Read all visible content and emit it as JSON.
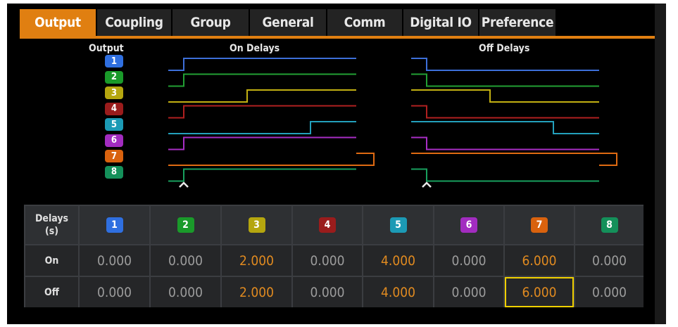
{
  "tabs": [
    {
      "label": "Output",
      "active": true
    },
    {
      "label": "Coupling",
      "active": false
    },
    {
      "label": "Group",
      "active": false
    },
    {
      "label": "General",
      "active": false
    },
    {
      "label": "Comm",
      "active": false
    },
    {
      "label": "Digital IO",
      "active": false
    },
    {
      "label": "Preference",
      "active": false
    }
  ],
  "diagram": {
    "output_label": "Output",
    "on_title": "On Delays",
    "off_title": "Off Delays",
    "marker": "^"
  },
  "outputs": [
    {
      "label": "1",
      "color": "#2f6fe0",
      "line": "#3d6fd9",
      "on": 0.0,
      "off": 0.0
    },
    {
      "label": "2",
      "color": "#1a9a2a",
      "line": "#22a033",
      "on": 0.0,
      "off": 0.0
    },
    {
      "label": "3",
      "color": "#b5a60f",
      "line": "#c2b012",
      "on": 2.0,
      "off": 2.0
    },
    {
      "label": "4",
      "color": "#9a1c1c",
      "line": "#b02020",
      "on": 0.0,
      "off": 0.0
    },
    {
      "label": "5",
      "color": "#1c9ab5",
      "line": "#23a0bc",
      "on": 4.0,
      "off": 4.0
    },
    {
      "label": "6",
      "color": "#a22cc0",
      "line": "#a72ec5",
      "on": 0.0,
      "off": 0.0
    },
    {
      "label": "7",
      "color": "#d9620e",
      "line": "#df6a12",
      "on": 6.0,
      "off": 6.0
    },
    {
      "label": "8",
      "color": "#14905a",
      "line": "#18a05e",
      "on": 0.0,
      "off": 0.0
    }
  ],
  "table": {
    "header_label": "Delays\n(s)",
    "rows": [
      {
        "label": "On",
        "values": [
          "0.000",
          "0.000",
          "2.000",
          "0.000",
          "4.000",
          "0.000",
          "6.000",
          "0.000"
        ]
      },
      {
        "label": "Off",
        "values": [
          "0.000",
          "0.000",
          "2.000",
          "0.000",
          "4.000",
          "0.000",
          "6.000",
          "0.000"
        ]
      }
    ],
    "highlight_cols": [
      2,
      4,
      6
    ],
    "selected": {
      "row": 1,
      "col": 6
    }
  },
  "colors": {
    "accent": "#e07f11",
    "selection": "#f0d000"
  }
}
